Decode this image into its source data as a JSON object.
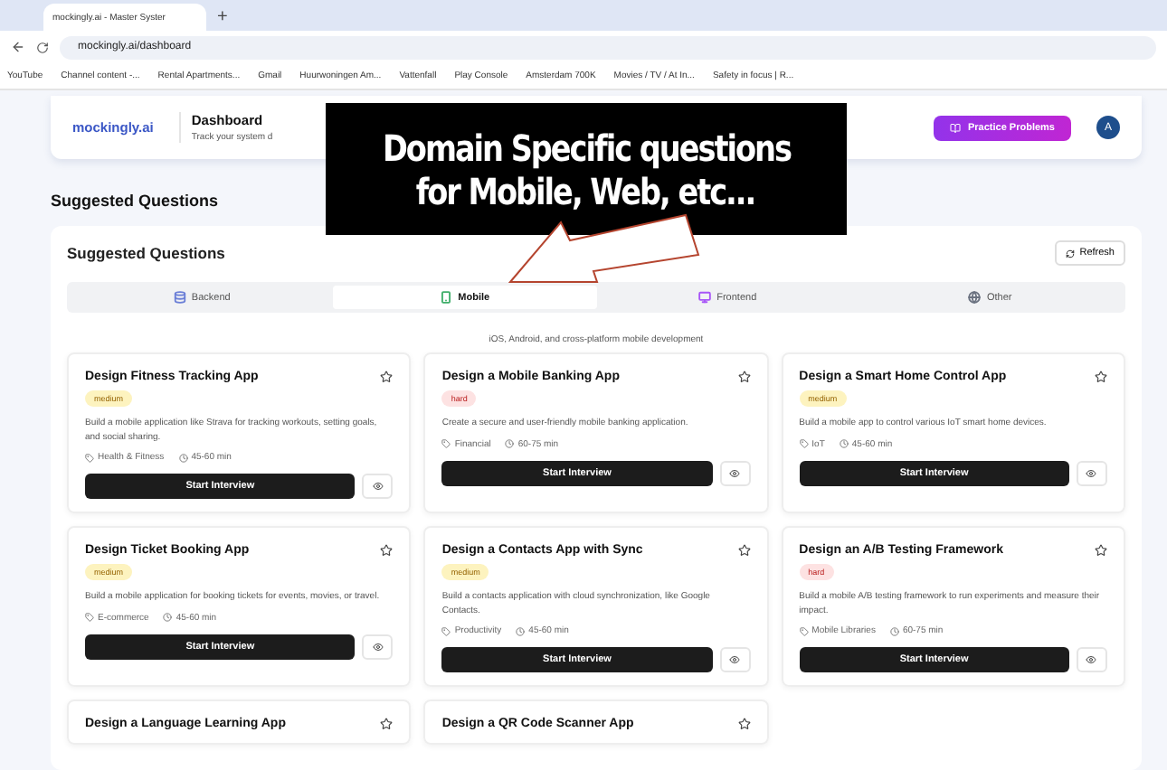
{
  "browser": {
    "tab_title": "mockingly.ai - Master Syster",
    "new_tab": "+",
    "url": "mockingly.ai/dashboard",
    "bookmarks": [
      "YouTube",
      "Channel content -...",
      "Rental Apartments...",
      "Gmail",
      "Huurwoningen Am...",
      "Vattenfall",
      "Play Console",
      "Amsterdam 700K",
      "Movies / TV / At In...",
      "Safety in focus | R..."
    ]
  },
  "header": {
    "logo": "mockingly.ai",
    "title": "Dashboard",
    "subtitle": "Track your system d",
    "practice_button": "Practice Problems",
    "avatar": "A"
  },
  "section_title": "Suggested Questions",
  "panel": {
    "title": "Suggested Questions",
    "refresh": "Refresh",
    "tabs": [
      {
        "label": "Backend",
        "selected": false,
        "color": "#6b7fd7"
      },
      {
        "label": "Mobile",
        "selected": true,
        "color": "#3fae6a"
      },
      {
        "label": "Frontend",
        "selected": false,
        "color": "#a855f7"
      },
      {
        "label": "Other",
        "selected": false,
        "color": "#6b7280"
      }
    ],
    "description": "iOS, Android, and cross-platform mobile development",
    "cards": [
      {
        "title": "Design Fitness Tracking App",
        "difficulty": "medium",
        "text": "Build a mobile application like Strava for tracking workouts, setting goals, and social sharing.",
        "category": "Health & Fitness",
        "duration": "45-60 min",
        "button": "Start Interview"
      },
      {
        "title": "Design a Mobile Banking App",
        "difficulty": "hard",
        "text": "Create a secure and user-friendly mobile banking application.",
        "category": "Financial",
        "duration": "60-75 min",
        "button": "Start Interview"
      },
      {
        "title": "Design a Smart Home Control App",
        "difficulty": "medium",
        "text": "Build a mobile app to control various IoT smart home devices.",
        "category": "IoT",
        "duration": "45-60 min",
        "button": "Start Interview"
      },
      {
        "title": "Design Ticket Booking App",
        "difficulty": "medium",
        "text": "Build a mobile application for booking tickets for events, movies, or travel.",
        "category": "E-commerce",
        "duration": "45-60 min",
        "button": "Start Interview"
      },
      {
        "title": "Design a Contacts App with Sync",
        "difficulty": "medium",
        "text": "Build a contacts application with cloud synchronization, like Google Contacts.",
        "category": "Productivity",
        "duration": "45-60 min",
        "button": "Start Interview"
      },
      {
        "title": "Design an A/B Testing Framework",
        "difficulty": "hard",
        "text": "Build a mobile A/B testing framework to run experiments and measure their impact.",
        "category": "Mobile Libraries",
        "duration": "60-75 min",
        "button": "Start Interview"
      },
      {
        "title": "Design a Language Learning App"
      },
      {
        "title": "Design a QR Code Scanner App"
      }
    ]
  },
  "callout": {
    "lines": [
      "Domain Specific questions",
      "for Mobile, Web, etc..."
    ]
  }
}
